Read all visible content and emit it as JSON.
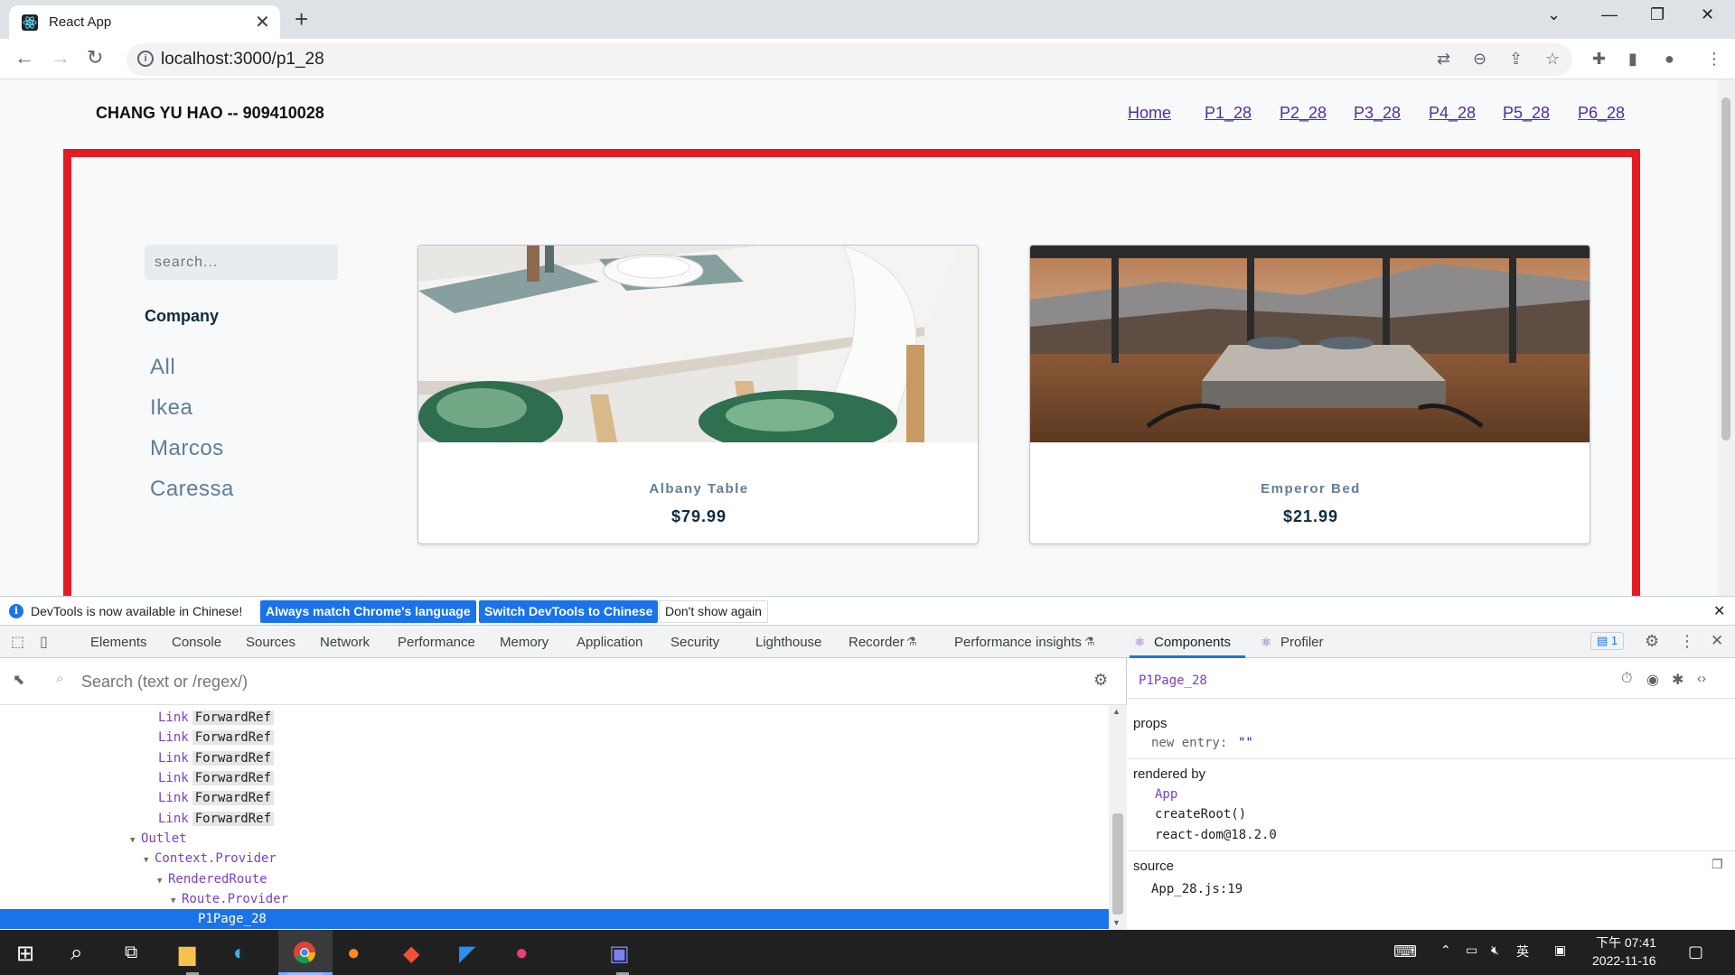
{
  "browser": {
    "tab_title": "React App",
    "url": "localhost:3000/p1_28",
    "close_tab": "✕",
    "new_tab": "+"
  },
  "page": {
    "brand": "CHANG YU HAO -- 909410028",
    "nav": [
      "Home",
      "P1_28",
      "P2_28",
      "P3_28",
      "P4_28",
      "P5_28",
      "P6_28"
    ],
    "search_placeholder": "search...",
    "company_heading": "Company",
    "companies": [
      "All",
      "Ikea",
      "Marcos",
      "Caressa"
    ],
    "products": [
      {
        "name": "Albany Table",
        "price": "$79.99"
      },
      {
        "name": "Emperor Bed",
        "price": "$21.99"
      }
    ]
  },
  "devtools": {
    "notice": "DevTools is now available in Chinese!",
    "btn_match": "Always match Chrome's language",
    "btn_switch": "Switch DevTools to Chinese",
    "btn_dont": "Don't show again",
    "tabs": [
      "Elements",
      "Console",
      "Sources",
      "Network",
      "Performance",
      "Memory",
      "Application",
      "Security",
      "Lighthouse",
      "Recorder",
      "Performance insights",
      "Components",
      "Profiler"
    ],
    "issues_count": "1",
    "search_placeholder": "Search (text or /regex/)",
    "tree": [
      {
        "name": "Link",
        "key": "ForwardRef",
        "indent": 0
      },
      {
        "name": "Link",
        "key": "ForwardRef",
        "indent": 0
      },
      {
        "name": "Link",
        "key": "ForwardRef",
        "indent": 0
      },
      {
        "name": "Link",
        "key": "ForwardRef",
        "indent": 0
      },
      {
        "name": "Link",
        "key": "ForwardRef",
        "indent": 0
      },
      {
        "name": "Link",
        "key": "ForwardRef",
        "indent": 0
      },
      {
        "name": "Outlet",
        "key": "",
        "indent": 0
      },
      {
        "name": "Context.Provider",
        "key": "",
        "indent": 1
      },
      {
        "name": "RenderedRoute",
        "key": "",
        "indent": 2
      },
      {
        "name": "Route.Provider",
        "key": "",
        "indent": 3
      },
      {
        "name": "P1Page_28",
        "key": "",
        "indent": 4
      }
    ],
    "selected_component": "P1Page_28",
    "props_heading": "props",
    "prop_key": "new entry:",
    "prop_value": "\"\"",
    "rendered_by_heading": "rendered by",
    "rendered_by": [
      "App",
      "createRoot()",
      "react-dom@18.2.0"
    ],
    "source_heading": "source",
    "source_value": "App_28.js:19"
  },
  "taskbar": {
    "time": "下午 07:41",
    "date": "2022-11-16",
    "ime": "英"
  }
}
